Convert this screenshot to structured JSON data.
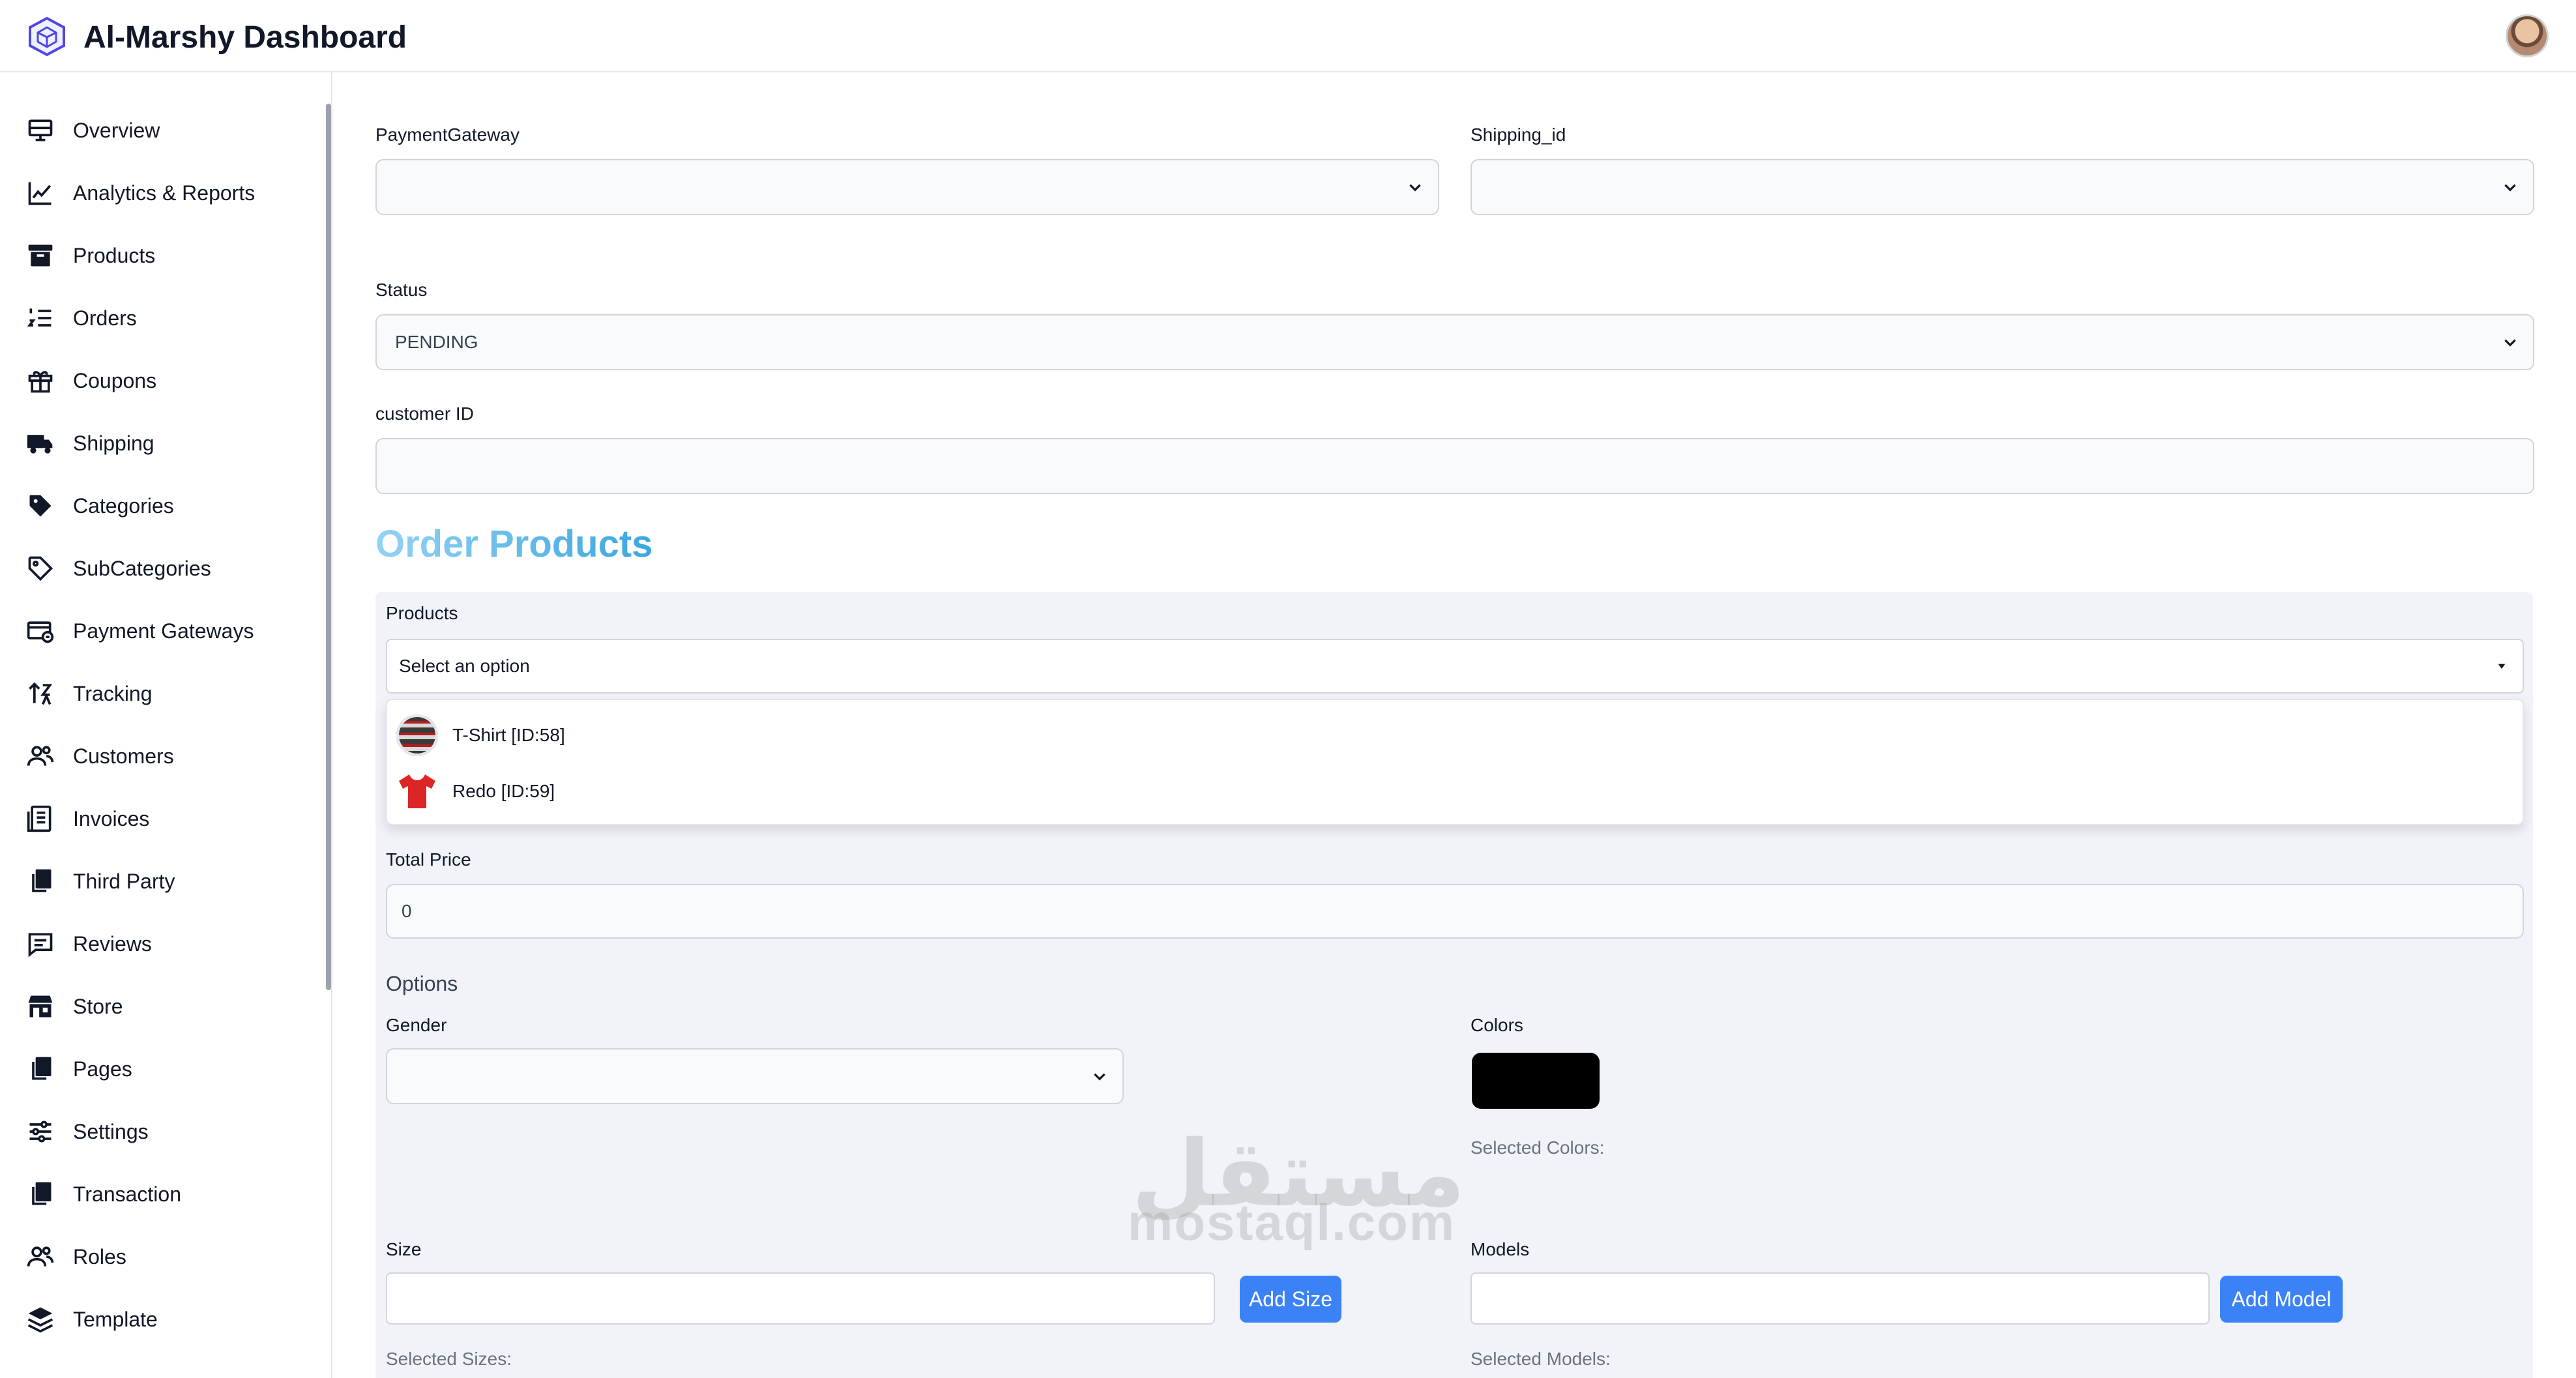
{
  "header": {
    "title": "Al-Marshy Dashboard"
  },
  "sidebar": {
    "items": [
      {
        "label": "Overview",
        "icon": "monitor-icon"
      },
      {
        "label": "Analytics & Reports",
        "icon": "line-chart-icon"
      },
      {
        "label": "Products",
        "icon": "archive-box-icon"
      },
      {
        "label": "Orders",
        "icon": "numbered-list-icon"
      },
      {
        "label": "Coupons",
        "icon": "gift-icon"
      },
      {
        "label": "Shipping",
        "icon": "truck-icon"
      },
      {
        "label": "Categories",
        "icon": "tag-filled-icon"
      },
      {
        "label": "SubCategories",
        "icon": "tag-outline-icon"
      },
      {
        "label": "Payment Gateways",
        "icon": "payment-card-icon"
      },
      {
        "label": "Tracking",
        "icon": "sort-arrows-icon"
      },
      {
        "label": "Customers",
        "icon": "users-icon"
      },
      {
        "label": "Invoices",
        "icon": "invoice-icon"
      },
      {
        "label": "Third Party",
        "icon": "copy-docs-icon"
      },
      {
        "label": "Reviews",
        "icon": "chat-icon"
      },
      {
        "label": "Store",
        "icon": "store-icon"
      },
      {
        "label": "Pages",
        "icon": "copy-docs-icon"
      },
      {
        "label": "Settings",
        "icon": "sliders-icon"
      },
      {
        "label": "Transaction",
        "icon": "copy-docs-icon"
      },
      {
        "label": "Roles",
        "icon": "users-icon"
      },
      {
        "label": "Template",
        "icon": "layers-icon"
      }
    ]
  },
  "form": {
    "payment_gateway": {
      "label": "PaymentGateway",
      "value": ""
    },
    "shipping_id": {
      "label": "Shipping_id",
      "value": ""
    },
    "status": {
      "label": "Status",
      "value": "PENDING"
    },
    "customer_id": {
      "label": "customer ID",
      "value": ""
    }
  },
  "order_products": {
    "title": "Order Products",
    "products": {
      "label": "Products",
      "placeholder": "Select an option",
      "options": [
        {
          "label": "T-Shirt [ID:58]"
        },
        {
          "label": "Redo [ID:59]"
        }
      ]
    },
    "total_price": {
      "label": "Total Price",
      "value": "0"
    },
    "options_heading": "Options",
    "gender": {
      "label": "Gender",
      "value": ""
    },
    "colors": {
      "label": "Colors",
      "swatch": "#000000",
      "selected_label": "Selected Colors:"
    },
    "size": {
      "label": "Size",
      "value": "",
      "button": "Add Size",
      "selected_label": "Selected Sizes:"
    },
    "models": {
      "label": "Models",
      "value": "",
      "button": "Add Model",
      "selected_label": "Selected Models:"
    }
  },
  "watermark": {
    "text": "mostaql.com",
    "arabic": "مستقل"
  },
  "colors": {
    "accent": "#3b82f6",
    "panel": "#f1f3f8"
  }
}
